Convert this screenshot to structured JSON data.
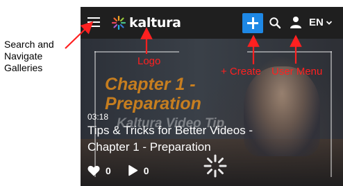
{
  "annotations": {
    "left_label_lines": [
      "Search and",
      "Navigate",
      "Galleries"
    ],
    "logo_label": "Logo",
    "create_label": "+ Create",
    "user_menu_label": "User Menu",
    "arrow_color": "#ff2020"
  },
  "header": {
    "menu_icon": "hamburger-icon",
    "logo_text": "kaltura",
    "create_icon": "plus-icon",
    "search_icon": "search-icon",
    "user_icon": "user-icon",
    "language": "EN",
    "accent_color": "#1e88e5"
  },
  "video": {
    "thumbnail_title": "Chapter 1 -\nPreparation",
    "thumbnail_subtitle": "Kaltura Video Tip",
    "duration": "03:18",
    "title": "Tips & Tricks for Better Videos - Chapter 1 - Preparation",
    "likes": "0",
    "plays": "0"
  }
}
